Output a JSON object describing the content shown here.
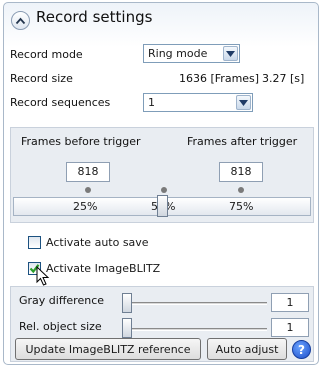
{
  "header": {
    "title": "Record settings",
    "collapse_icon": "chevron-up-icon"
  },
  "record_mode": {
    "label": "Record mode",
    "value": "Ring mode"
  },
  "record_size": {
    "label": "Record size",
    "frames": "1636 [Frames]",
    "seconds": "3.27 [s]"
  },
  "record_sequences": {
    "label": "Record sequences",
    "value": "1"
  },
  "trigger": {
    "before_label": "Frames before trigger",
    "after_label": "Frames after trigger",
    "before_value": "818",
    "after_value": "818",
    "ticks": [
      "25%",
      "50%",
      "75%"
    ],
    "slider_percent": 50
  },
  "auto_save": {
    "label": "Activate auto save",
    "checked": false
  },
  "imageblitz": {
    "label": "Activate ImageBLITZ",
    "checked": true
  },
  "gray_difference": {
    "label": "Gray difference",
    "value": "1"
  },
  "rel_object_size": {
    "label": "Rel. object size",
    "value": "1"
  },
  "buttons": {
    "update": "Update ImageBLITZ reference",
    "auto_adjust": "Auto adjust",
    "help_icon": "help-icon"
  },
  "colors": {
    "accent": "#1d4fc9",
    "check": "#2a9d2a",
    "panel_border": "#a9b8c9"
  }
}
